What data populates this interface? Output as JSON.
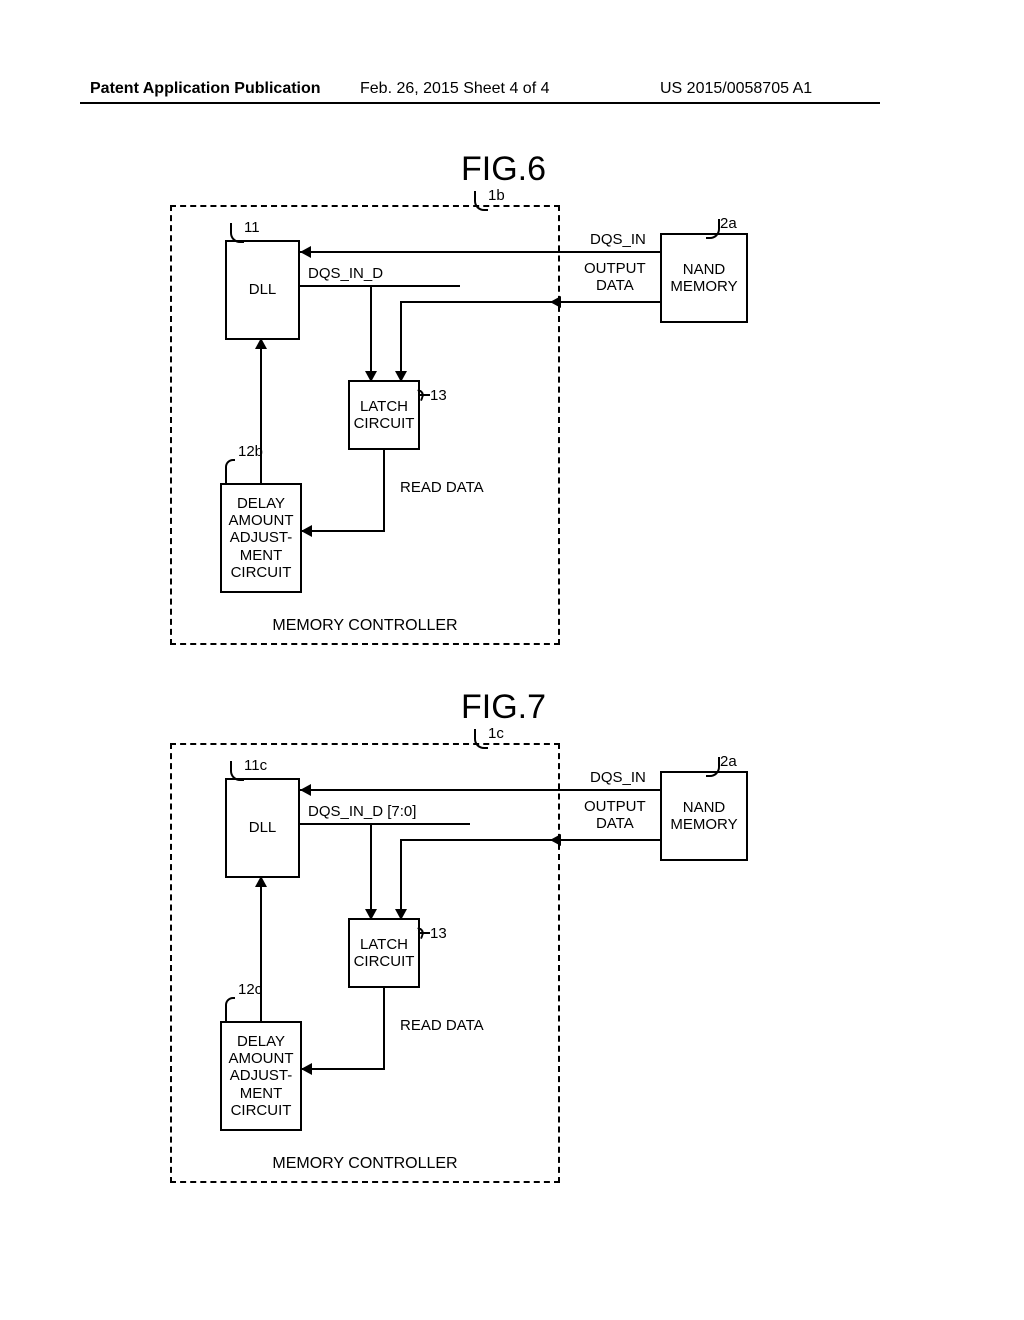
{
  "header": {
    "left": "Patent Application Publication",
    "center": "Feb. 26, 2015  Sheet 4 of 4",
    "right": "US 2015/0058705 A1"
  },
  "fig6": {
    "title": "FIG.6",
    "controller_ref": "1b",
    "dll_ref": "11",
    "latch_ref": "13",
    "delay_ref": "12b",
    "nand_ref": "2a",
    "dll_label": "DLL",
    "latch_label": "LATCH\nCIRCUIT",
    "delay_label": "DELAY\nAMOUNT\nADJUST-\nMENT\nCIRCUIT",
    "nand_label": "NAND\nMEMORY",
    "controller_label": "MEMORY CONTROLLER",
    "sig_dqs_in_d": "DQS_IN_D",
    "sig_dqs_in": "DQS_IN",
    "sig_output_data": "OUTPUT\nDATA",
    "sig_read_data": "READ DATA"
  },
  "fig7": {
    "title": "FIG.7",
    "controller_ref": "1c",
    "dll_ref": "11c",
    "latch_ref": "13",
    "delay_ref": "12c",
    "nand_ref": "2a",
    "dll_label": "DLL",
    "latch_label": "LATCH\nCIRCUIT",
    "delay_label": "DELAY\nAMOUNT\nADJUST-\nMENT\nCIRCUIT",
    "nand_label": "NAND\nMEMORY",
    "controller_label": "MEMORY CONTROLLER",
    "sig_dqs_in_d": "DQS_IN_D [7:0]",
    "sig_dqs_in": "DQS_IN",
    "sig_output_data": "OUTPUT\nDATA",
    "sig_read_data": "READ DATA"
  }
}
